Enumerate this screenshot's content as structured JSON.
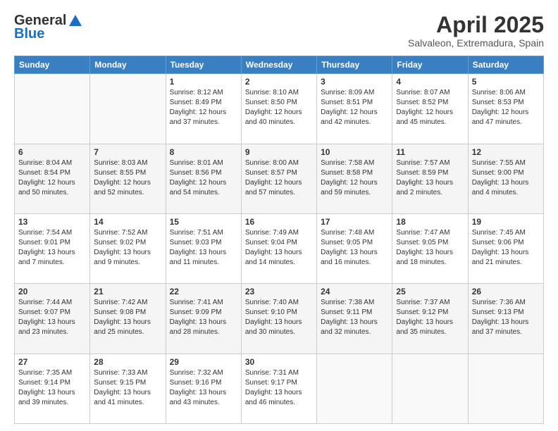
{
  "header": {
    "logo_line1": "General",
    "logo_line2": "Blue",
    "title": "April 2025",
    "subtitle": "Salvaleon, Extremadura, Spain"
  },
  "days_of_week": [
    "Sunday",
    "Monday",
    "Tuesday",
    "Wednesday",
    "Thursday",
    "Friday",
    "Saturday"
  ],
  "weeks": [
    {
      "days": [
        {
          "num": "",
          "sunrise": "",
          "sunset": "",
          "daylight": ""
        },
        {
          "num": "",
          "sunrise": "",
          "sunset": "",
          "daylight": ""
        },
        {
          "num": "1",
          "sunrise": "Sunrise: 8:12 AM",
          "sunset": "Sunset: 8:49 PM",
          "daylight": "Daylight: 12 hours and 37 minutes."
        },
        {
          "num": "2",
          "sunrise": "Sunrise: 8:10 AM",
          "sunset": "Sunset: 8:50 PM",
          "daylight": "Daylight: 12 hours and 40 minutes."
        },
        {
          "num": "3",
          "sunrise": "Sunrise: 8:09 AM",
          "sunset": "Sunset: 8:51 PM",
          "daylight": "Daylight: 12 hours and 42 minutes."
        },
        {
          "num": "4",
          "sunrise": "Sunrise: 8:07 AM",
          "sunset": "Sunset: 8:52 PM",
          "daylight": "Daylight: 12 hours and 45 minutes."
        },
        {
          "num": "5",
          "sunrise": "Sunrise: 8:06 AM",
          "sunset": "Sunset: 8:53 PM",
          "daylight": "Daylight: 12 hours and 47 minutes."
        }
      ]
    },
    {
      "days": [
        {
          "num": "6",
          "sunrise": "Sunrise: 8:04 AM",
          "sunset": "Sunset: 8:54 PM",
          "daylight": "Daylight: 12 hours and 50 minutes."
        },
        {
          "num": "7",
          "sunrise": "Sunrise: 8:03 AM",
          "sunset": "Sunset: 8:55 PM",
          "daylight": "Daylight: 12 hours and 52 minutes."
        },
        {
          "num": "8",
          "sunrise": "Sunrise: 8:01 AM",
          "sunset": "Sunset: 8:56 PM",
          "daylight": "Daylight: 12 hours and 54 minutes."
        },
        {
          "num": "9",
          "sunrise": "Sunrise: 8:00 AM",
          "sunset": "Sunset: 8:57 PM",
          "daylight": "Daylight: 12 hours and 57 minutes."
        },
        {
          "num": "10",
          "sunrise": "Sunrise: 7:58 AM",
          "sunset": "Sunset: 8:58 PM",
          "daylight": "Daylight: 12 hours and 59 minutes."
        },
        {
          "num": "11",
          "sunrise": "Sunrise: 7:57 AM",
          "sunset": "Sunset: 8:59 PM",
          "daylight": "Daylight: 13 hours and 2 minutes."
        },
        {
          "num": "12",
          "sunrise": "Sunrise: 7:55 AM",
          "sunset": "Sunset: 9:00 PM",
          "daylight": "Daylight: 13 hours and 4 minutes."
        }
      ]
    },
    {
      "days": [
        {
          "num": "13",
          "sunrise": "Sunrise: 7:54 AM",
          "sunset": "Sunset: 9:01 PM",
          "daylight": "Daylight: 13 hours and 7 minutes."
        },
        {
          "num": "14",
          "sunrise": "Sunrise: 7:52 AM",
          "sunset": "Sunset: 9:02 PM",
          "daylight": "Daylight: 13 hours and 9 minutes."
        },
        {
          "num": "15",
          "sunrise": "Sunrise: 7:51 AM",
          "sunset": "Sunset: 9:03 PM",
          "daylight": "Daylight: 13 hours and 11 minutes."
        },
        {
          "num": "16",
          "sunrise": "Sunrise: 7:49 AM",
          "sunset": "Sunset: 9:04 PM",
          "daylight": "Daylight: 13 hours and 14 minutes."
        },
        {
          "num": "17",
          "sunrise": "Sunrise: 7:48 AM",
          "sunset": "Sunset: 9:05 PM",
          "daylight": "Daylight: 13 hours and 16 minutes."
        },
        {
          "num": "18",
          "sunrise": "Sunrise: 7:47 AM",
          "sunset": "Sunset: 9:05 PM",
          "daylight": "Daylight: 13 hours and 18 minutes."
        },
        {
          "num": "19",
          "sunrise": "Sunrise: 7:45 AM",
          "sunset": "Sunset: 9:06 PM",
          "daylight": "Daylight: 13 hours and 21 minutes."
        }
      ]
    },
    {
      "days": [
        {
          "num": "20",
          "sunrise": "Sunrise: 7:44 AM",
          "sunset": "Sunset: 9:07 PM",
          "daylight": "Daylight: 13 hours and 23 minutes."
        },
        {
          "num": "21",
          "sunrise": "Sunrise: 7:42 AM",
          "sunset": "Sunset: 9:08 PM",
          "daylight": "Daylight: 13 hours and 25 minutes."
        },
        {
          "num": "22",
          "sunrise": "Sunrise: 7:41 AM",
          "sunset": "Sunset: 9:09 PM",
          "daylight": "Daylight: 13 hours and 28 minutes."
        },
        {
          "num": "23",
          "sunrise": "Sunrise: 7:40 AM",
          "sunset": "Sunset: 9:10 PM",
          "daylight": "Daylight: 13 hours and 30 minutes."
        },
        {
          "num": "24",
          "sunrise": "Sunrise: 7:38 AM",
          "sunset": "Sunset: 9:11 PM",
          "daylight": "Daylight: 13 hours and 32 minutes."
        },
        {
          "num": "25",
          "sunrise": "Sunrise: 7:37 AM",
          "sunset": "Sunset: 9:12 PM",
          "daylight": "Daylight: 13 hours and 35 minutes."
        },
        {
          "num": "26",
          "sunrise": "Sunrise: 7:36 AM",
          "sunset": "Sunset: 9:13 PM",
          "daylight": "Daylight: 13 hours and 37 minutes."
        }
      ]
    },
    {
      "days": [
        {
          "num": "27",
          "sunrise": "Sunrise: 7:35 AM",
          "sunset": "Sunset: 9:14 PM",
          "daylight": "Daylight: 13 hours and 39 minutes."
        },
        {
          "num": "28",
          "sunrise": "Sunrise: 7:33 AM",
          "sunset": "Sunset: 9:15 PM",
          "daylight": "Daylight: 13 hours and 41 minutes."
        },
        {
          "num": "29",
          "sunrise": "Sunrise: 7:32 AM",
          "sunset": "Sunset: 9:16 PM",
          "daylight": "Daylight: 13 hours and 43 minutes."
        },
        {
          "num": "30",
          "sunrise": "Sunrise: 7:31 AM",
          "sunset": "Sunset: 9:17 PM",
          "daylight": "Daylight: 13 hours and 46 minutes."
        },
        {
          "num": "",
          "sunrise": "",
          "sunset": "",
          "daylight": ""
        },
        {
          "num": "",
          "sunrise": "",
          "sunset": "",
          "daylight": ""
        },
        {
          "num": "",
          "sunrise": "",
          "sunset": "",
          "daylight": ""
        }
      ]
    }
  ]
}
